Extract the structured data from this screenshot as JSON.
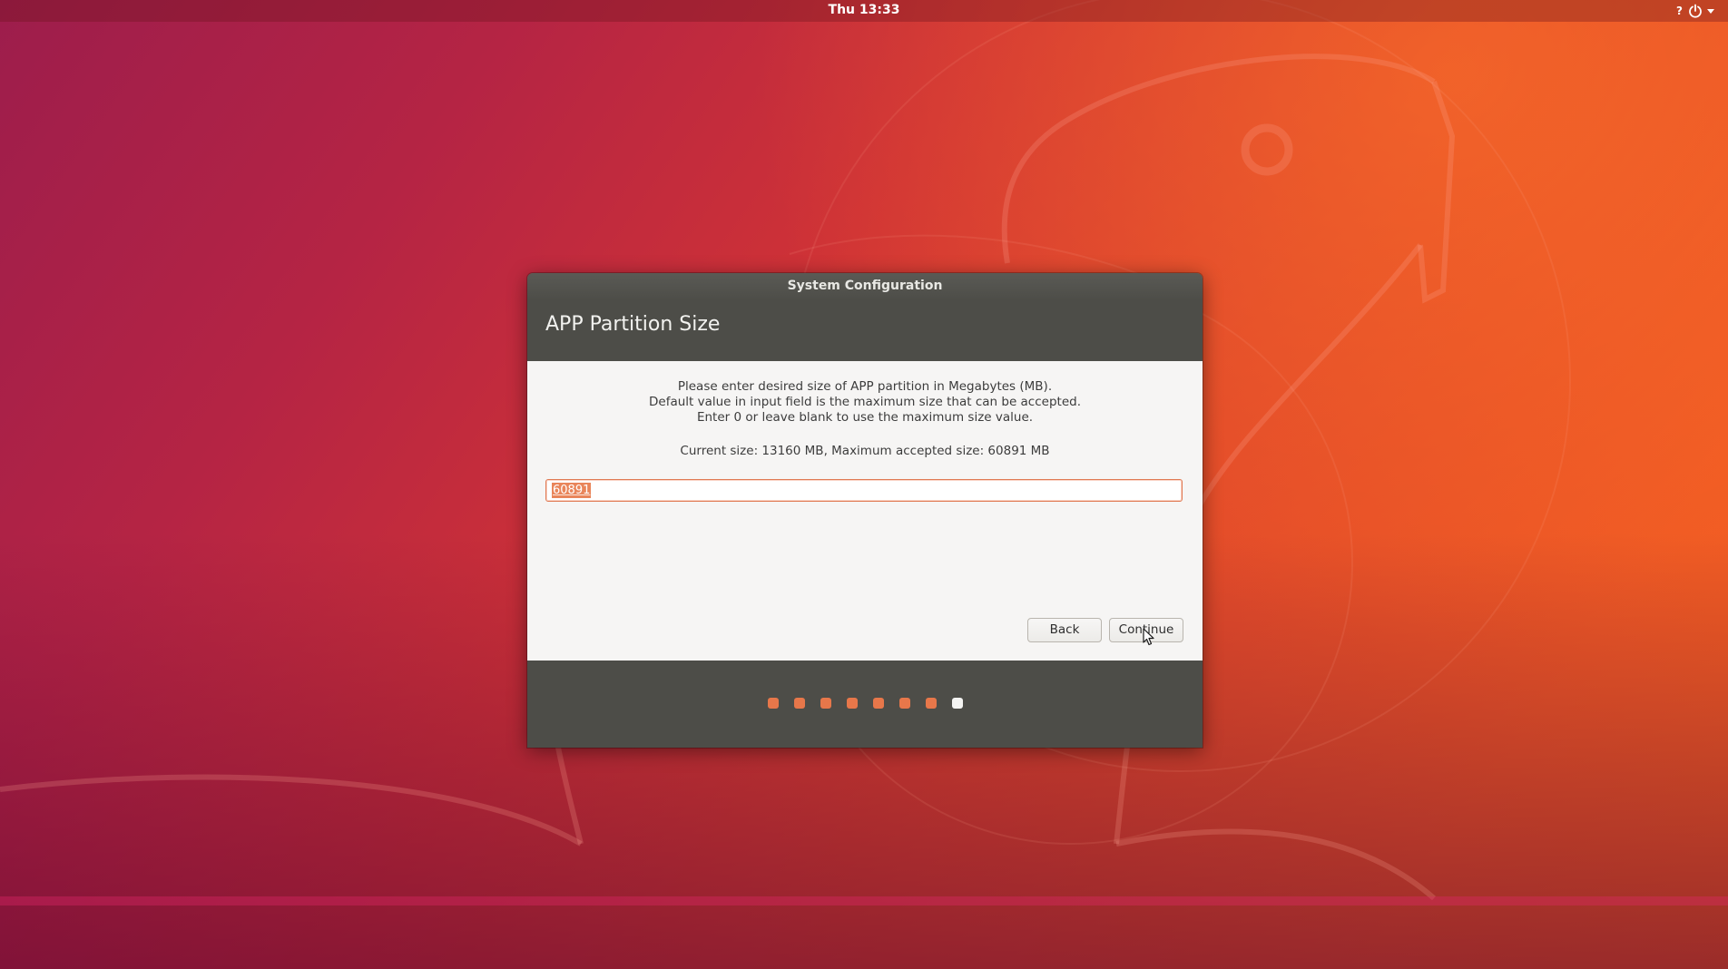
{
  "top_bar": {
    "clock": "Thu 13:33",
    "help_label": "?",
    "power_icon": "power-icon",
    "menu_icon": "chevron-down-icon"
  },
  "dialog": {
    "window_title": "System Configuration",
    "page_title": "APP Partition Size",
    "instructions": [
      "Please enter desired size of APP partition in Megabytes (MB).",
      "Default value in input field is the maximum size that can be accepted.",
      "Enter 0 or leave blank to use the maximum size value."
    ],
    "size_info": "Current size: 13160 MB, Maximum accepted size: 60891 MB",
    "size_input": {
      "value": "60891",
      "selected": true
    },
    "buttons": {
      "back": "Back",
      "continue": "Continue"
    },
    "progress": {
      "total_steps": 8,
      "current_step": 8
    }
  },
  "colors": {
    "accent": "#E95420",
    "dialog_header": "#4D4D48",
    "content_background": "#F6F5F4"
  }
}
